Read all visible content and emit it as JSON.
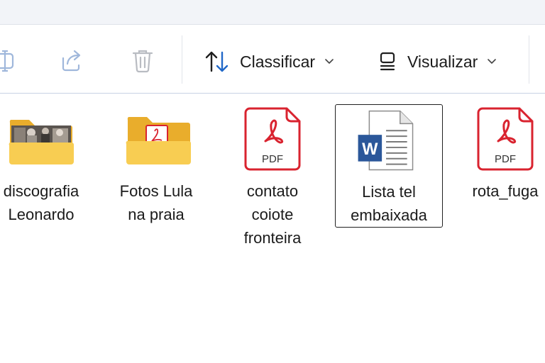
{
  "toolbar": {
    "rename_icon": "rename-icon",
    "share_icon": "share-icon",
    "delete_icon": "trash-icon",
    "sort_label": "Classificar",
    "view_label": "Visualizar"
  },
  "files": [
    {
      "name": "discografia\nLeonardo",
      "type": "folder-with-photos"
    },
    {
      "name": "Fotos Lula\nna praia",
      "type": "folder-with-pdf"
    },
    {
      "name": "contato\ncoiote\nfronteira",
      "type": "pdf"
    },
    {
      "name": "Lista tel\nembaixada",
      "type": "word",
      "selected": true
    },
    {
      "name": "rota_fuga",
      "type": "pdf"
    }
  ],
  "colors": {
    "pdf_red": "#d9232f",
    "folder_yellow": "#f6c94a",
    "word_blue": "#2b579a",
    "toolbar_icon_blue": "#2168c8"
  }
}
